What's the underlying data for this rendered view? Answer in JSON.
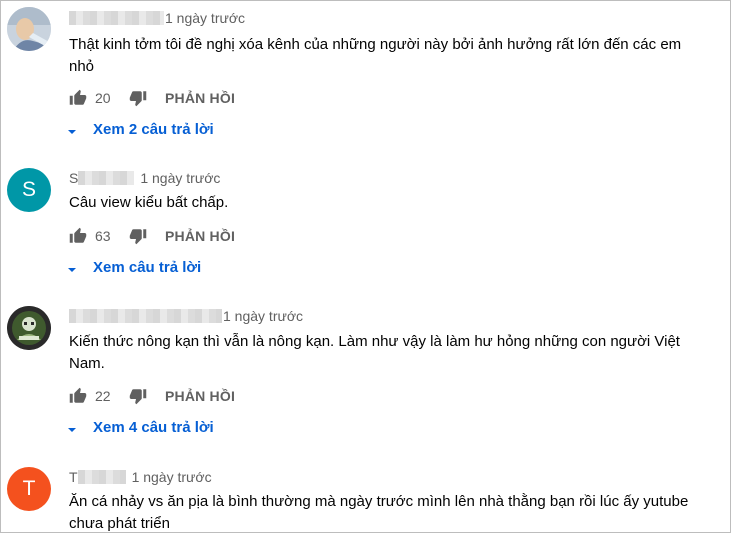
{
  "comments": [
    {
      "avatar_type": "photo",
      "time": "1 ngày trước",
      "text": "Thật kinh tởm tôi đề nghị xóa kênh của những người này bởi ảnh hưởng rất lớn đến các em nhỏ",
      "likes": "20",
      "reply_label": "PHẢN HỒI",
      "view_replies": "Xem 2 câu trả lời"
    },
    {
      "avatar_type": "letter",
      "avatar_letter": "S",
      "avatar_color": "#0097a7",
      "name_visible": "S",
      "time": "1 ngày trước",
      "text": "Câu view kiểu bất chấp.",
      "likes": "63",
      "reply_label": "PHẢN HỒI",
      "view_replies": "Xem câu trả lời"
    },
    {
      "avatar_type": "logo",
      "time": "1 ngày trước",
      "text": "Kiến thức nông kạn thì vẫn là nông kạn. Làm như vậy là làm hư hỏng những con người Việt Nam.",
      "likes": "22",
      "reply_label": "PHẢN HỒI",
      "view_replies": "Xem 4 câu trả lời"
    },
    {
      "avatar_type": "letter",
      "avatar_letter": "T",
      "avatar_color": "#f4511e",
      "name_visible": "T",
      "time": "1 ngày trước",
      "text": "Ăn cá nhảy vs ăn pịa là bình thường mà ngày trước mình lên nhà thằng bạn rồi lúc ấy yutube chưa phát triển"
    }
  ],
  "colors": {
    "link": "#065fd4",
    "meta": "#606060",
    "text": "#030303"
  },
  "icons": [
    "thumb-up-icon",
    "thumb-down-icon",
    "caret-down-icon"
  ]
}
